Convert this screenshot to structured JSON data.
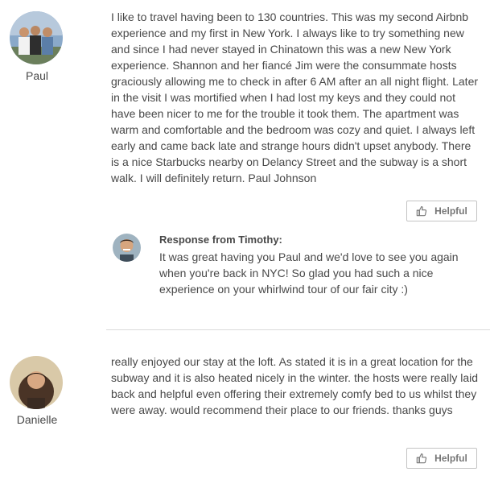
{
  "reviews": [
    {
      "reviewer": "Paul",
      "avatar_icon": "reviewer-photo-paul",
      "text": "I like to travel having been to 130 countries. This was my second Airbnb experience and my first in New York. I always like to try something new and since I had never stayed in Chinatown this was a new New York experience. Shannon and her fiancé Jim were the consummate hosts graciously allowing me to check in after 6 AM after an all night flight. Later in the visit I was mortified when I had lost my keys and they could not have been nicer to me for the trouble it took them. The apartment was warm and comfortable and the bedroom was cozy and quiet. I always left early and came back late and strange hours didn't upset anybody. There is a nice Starbucks nearby on Delancy Street and the subway is a short walk. I will definitely return. Paul Johnson",
      "helpful_label": "Helpful",
      "response": {
        "title": "Response from Timothy:",
        "text": "It was great having you Paul and we'd love to see you again when you're back in NYC! So glad you had such a nice experience on your whirlwind tour of our fair city :)"
      }
    },
    {
      "reviewer": "Danielle",
      "avatar_icon": "reviewer-photo-danielle",
      "text": "really enjoyed our stay at the loft. As stated it is in a great location for the subway and it is also heated nicely in the winter. the hosts were really laid back and helpful even offering their extremely comfy bed to us whilst they were away. would recommend their place to our friends. thanks guys",
      "helpful_label": "Helpful"
    }
  ],
  "colors": {
    "text": "#484848",
    "button_border": "#c4c4c4",
    "button_text": "#767676",
    "divider": "#dbdbdb"
  }
}
